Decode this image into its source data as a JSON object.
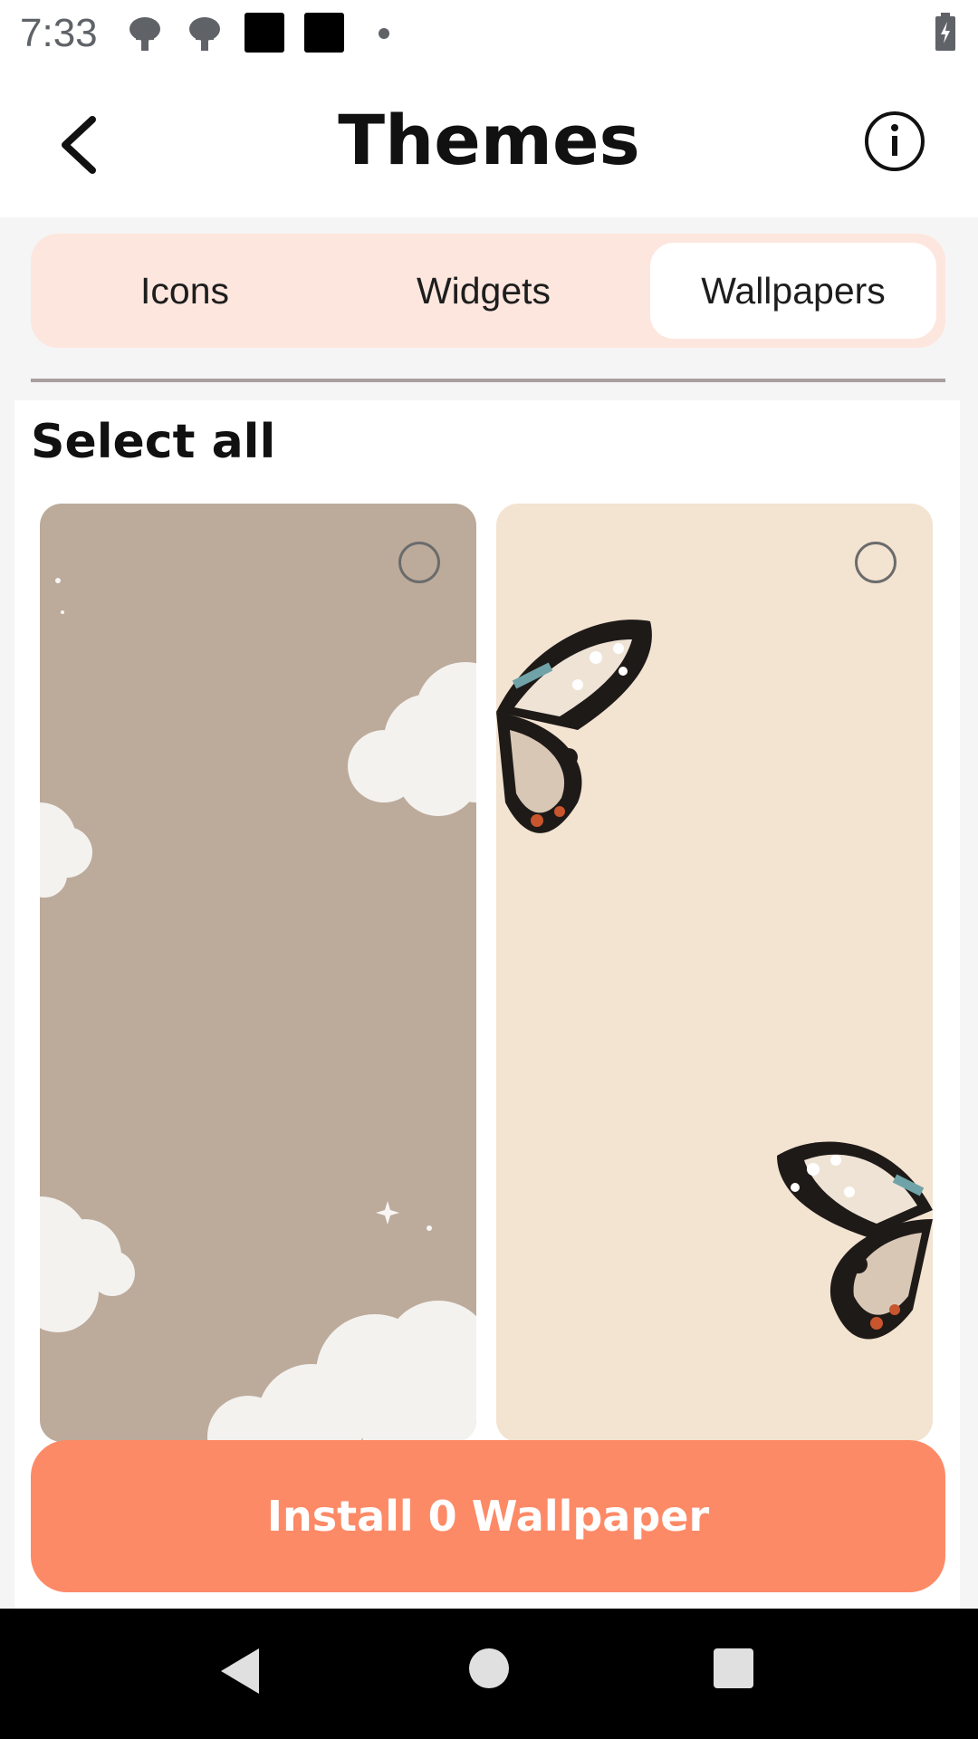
{
  "status_bar": {
    "time": "7:33",
    "icons": [
      "android-icon",
      "android-icon",
      "square-icon",
      "square-icon",
      "dot-icon",
      "battery-charging-icon"
    ]
  },
  "header": {
    "title": "Themes",
    "back_icon": "chevron-left-icon",
    "info_icon": "info-icon"
  },
  "tabs": [
    {
      "label": "Icons",
      "active": false
    },
    {
      "label": "Widgets",
      "active": false
    },
    {
      "label": "Wallpapers",
      "active": true
    }
  ],
  "content": {
    "select_all_label": "Select all",
    "wallpapers": [
      {
        "theme": "beige clouds",
        "selected": false,
        "background": "#bcab9b"
      },
      {
        "theme": "butterflies on cream",
        "selected": false,
        "background": "#f3e3d1"
      }
    ]
  },
  "install_button": {
    "label": "Install 0 Wallpaper",
    "color": "#fd8a67"
  },
  "nav_bar": {
    "icons": [
      "back-triangle-icon",
      "home-circle-icon",
      "recents-square-icon"
    ]
  },
  "colors": {
    "tab_bg": "#fde6de",
    "accent": "#fd8a67"
  }
}
